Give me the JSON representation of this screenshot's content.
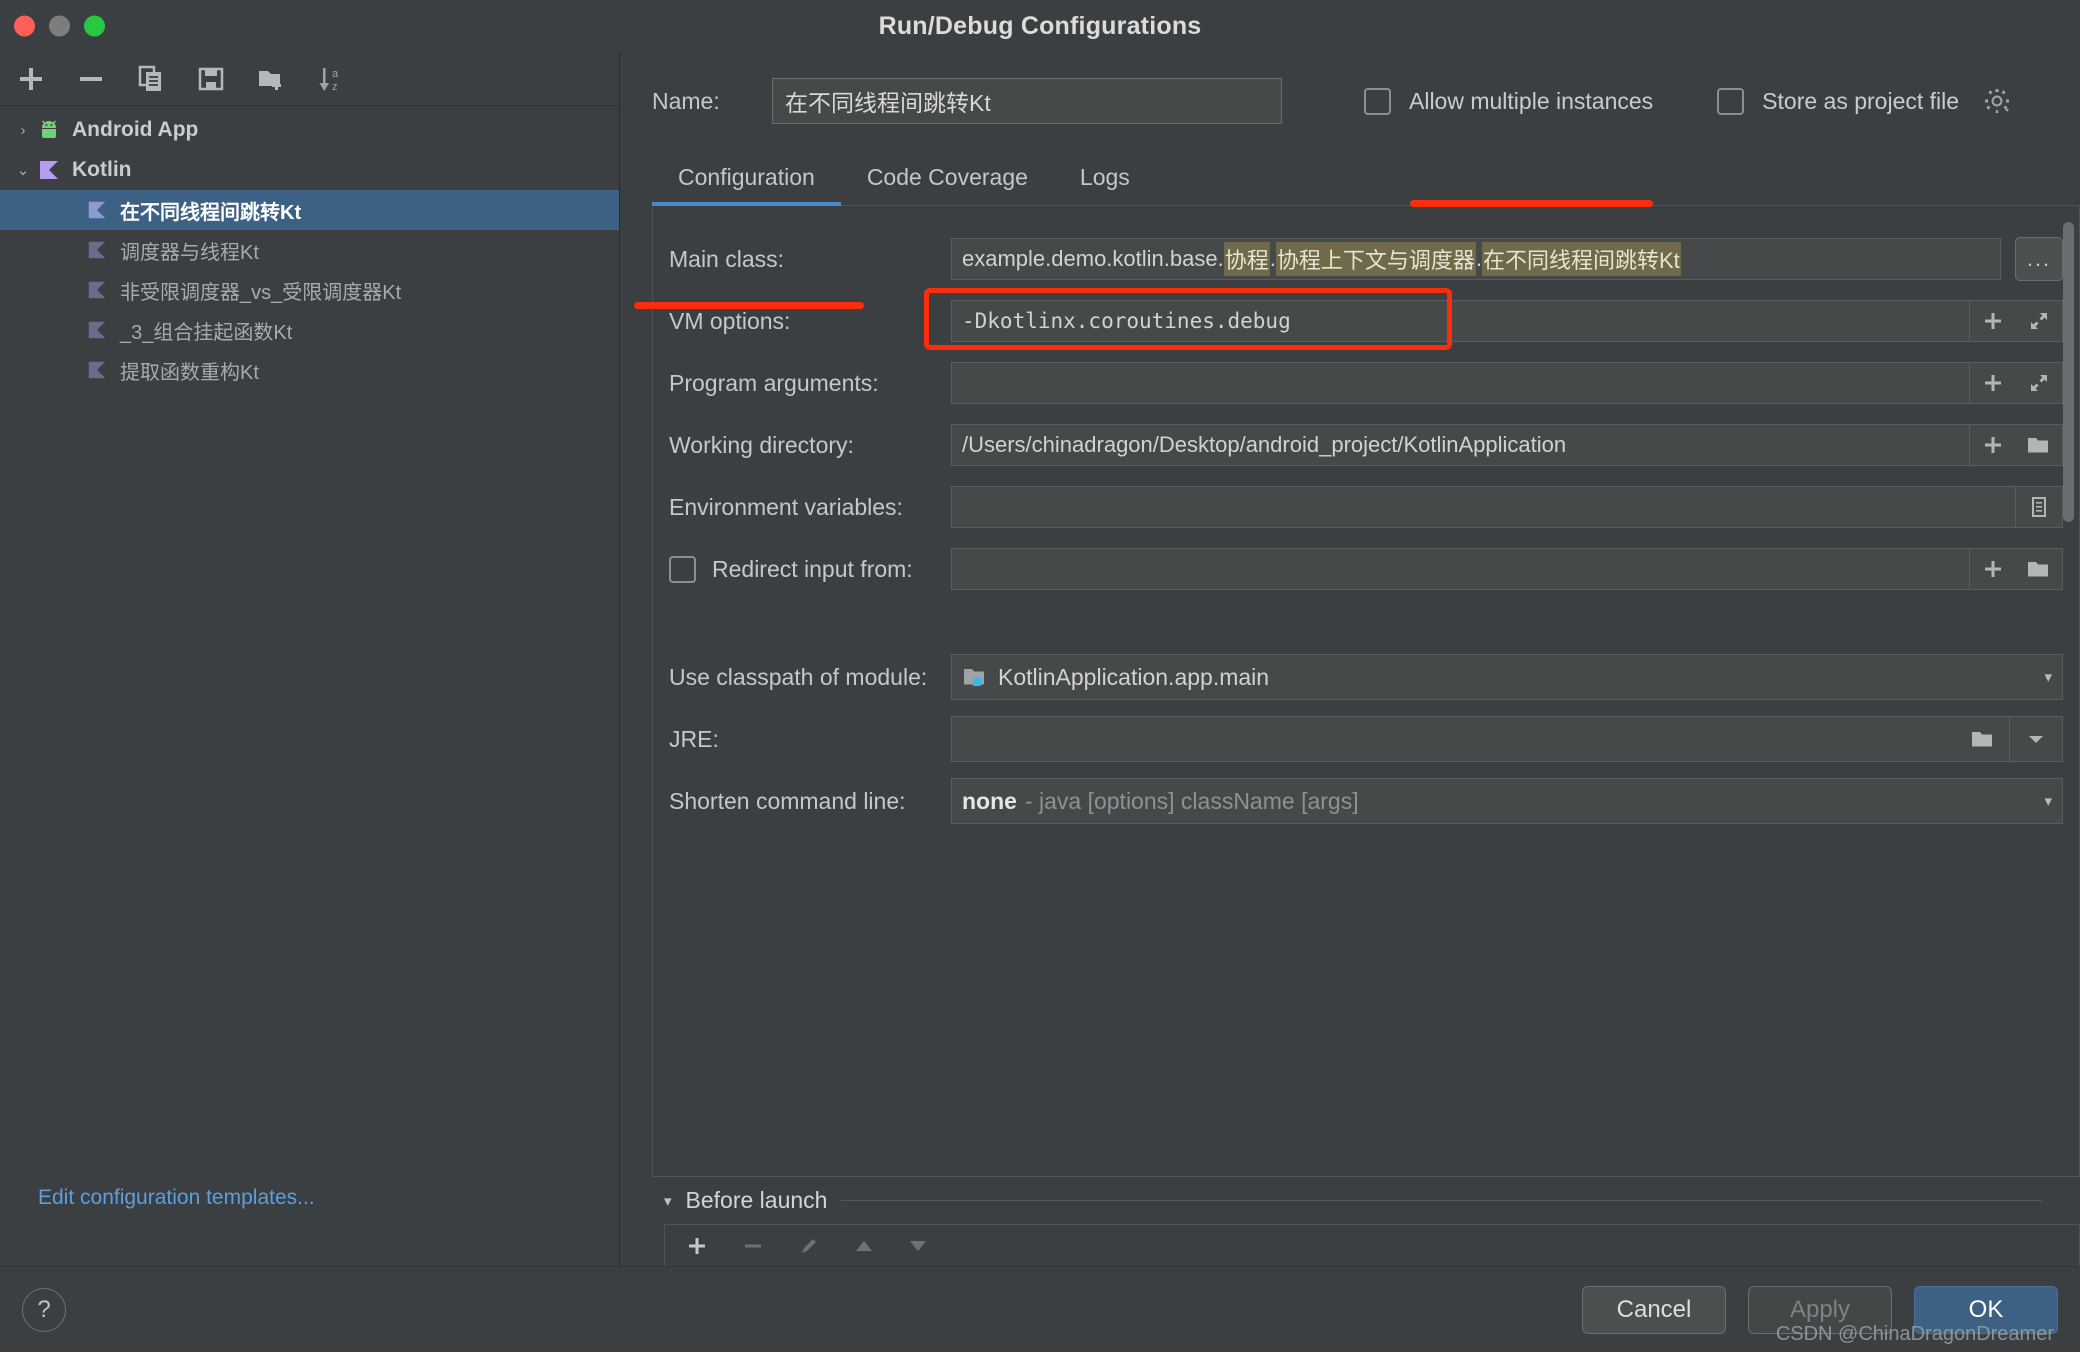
{
  "window": {
    "title": "Run/Debug Configurations",
    "traffic_lights": [
      "close-red",
      "minimize-gray",
      "zoom-green"
    ]
  },
  "left_panel": {
    "toolbar": [
      {
        "name": "add-configuration-button",
        "icon": "plus-icon"
      },
      {
        "name": "remove-configuration-button",
        "icon": "minus-icon"
      },
      {
        "name": "copy-configuration-button",
        "icon": "copy-icon"
      },
      {
        "name": "save-configuration-button",
        "icon": "save-icon"
      },
      {
        "name": "new-folder-button",
        "icon": "new-folder-icon"
      },
      {
        "name": "sort-configurations-button",
        "icon": "sort-az-icon"
      }
    ],
    "tree": [
      {
        "label": "Android App",
        "level": 0,
        "expanded": false,
        "twisty": "›",
        "icon": "android-icon",
        "selected": false
      },
      {
        "label": "Kotlin",
        "level": 0,
        "expanded": true,
        "twisty": "⌄",
        "icon": "kotlin-icon",
        "selected": false
      },
      {
        "label": "在不同线程间跳转Kt",
        "level": 1,
        "icon": "kotlin-file-icon",
        "selected": true
      },
      {
        "label": "调度器与线程Kt",
        "level": 1,
        "icon": "kotlin-file-icon",
        "selected": false
      },
      {
        "label": "非受限调度器_vs_受限调度器Kt",
        "level": 1,
        "icon": "kotlin-file-icon",
        "selected": false
      },
      {
        "label": "_3_组合挂起函数Kt",
        "level": 1,
        "icon": "kotlin-file-icon",
        "selected": false
      },
      {
        "label": "提取函数重构Kt",
        "level": 1,
        "icon": "kotlin-file-icon",
        "selected": false
      }
    ],
    "edit_templates_link": "Edit configuration templates..."
  },
  "header": {
    "name_label": "Name:",
    "name_value": "在不同线程间跳转Kt",
    "name_placeholder": "",
    "allow_multiple_instances": {
      "label": "Allow multiple instances",
      "checked": false
    },
    "store_as_project_file": {
      "label": "Store as project file",
      "checked": false,
      "icon": "gear-icon"
    }
  },
  "tabs": [
    {
      "label": "Configuration",
      "active": true
    },
    {
      "label": "Code Coverage",
      "active": false
    },
    {
      "label": "Logs",
      "active": false
    }
  ],
  "form": {
    "main_class": {
      "label": "Main class:",
      "prefix": "example.demo.kotlin.base.",
      "segments": [
        {
          "text": "协程",
          "highlight": true
        },
        {
          "text": ".",
          "highlight": false
        },
        {
          "text": "协程上下文与调度器",
          "highlight": true
        },
        {
          "text": ".",
          "highlight": false
        },
        {
          "text": "在不同线程间跳转Kt",
          "highlight": true
        }
      ],
      "browse_label": "..."
    },
    "vm_options": {
      "label": "VM options:",
      "value": "-Dkotlinx.coroutines.debug",
      "actions": [
        "plus-icon",
        "expand-icon"
      ]
    },
    "program_arguments": {
      "label": "Program arguments:",
      "value": "",
      "actions": [
        "plus-icon",
        "expand-icon"
      ]
    },
    "working_directory": {
      "label": "Working directory:",
      "value": "/Users/chinadragon/Desktop/android_project/KotlinApplication",
      "actions": [
        "plus-icon",
        "folder-icon"
      ]
    },
    "environment_variables": {
      "label": "Environment variables:",
      "value": "",
      "actions": [
        "list-icon"
      ]
    },
    "redirect_input": {
      "label": "Redirect input from:",
      "checked": false,
      "value": "",
      "actions": [
        "plus-icon",
        "folder-icon"
      ]
    },
    "module_classpath": {
      "label": "Use classpath of module:",
      "value": "KotlinApplication.app.main",
      "icon": "module-icon",
      "caret": "▾"
    },
    "jre": {
      "label": "JRE:",
      "value": "",
      "actions": [
        "folder-icon",
        "caret-down-icon"
      ]
    },
    "shorten_command_line": {
      "label": "Shorten command line:",
      "value_strong": "none",
      "value_dim": "- java [options] className [args]",
      "caret": "▾"
    }
  },
  "before_launch": {
    "title": "Before launch",
    "caret": "▾",
    "toolbar": [
      {
        "name": "add-task-button",
        "icon": "plus-icon",
        "enabled": true
      },
      {
        "name": "remove-task-button",
        "icon": "minus-icon",
        "enabled": false
      },
      {
        "name": "edit-task-button",
        "icon": "pencil-icon",
        "enabled": false
      },
      {
        "name": "move-task-up-button",
        "icon": "arrow-up-icon",
        "enabled": false
      },
      {
        "name": "move-task-down-button",
        "icon": "arrow-down-icon",
        "enabled": false
      }
    ]
  },
  "footer": {
    "help_label": "?",
    "cancel_label": "Cancel",
    "apply_label": "Apply",
    "ok_label": "OK",
    "watermark": "CSDN @ChinaDragonDreamer"
  },
  "colors": {
    "accent_blue": "#3d6185",
    "tab_underline": "#4a88c7",
    "link_blue": "#5c9ede",
    "annotation_red": "#fb2d0a",
    "highlight_olive": "#6e6a4a",
    "panel_bg": "#3c3f41",
    "field_bg": "#45494a"
  }
}
